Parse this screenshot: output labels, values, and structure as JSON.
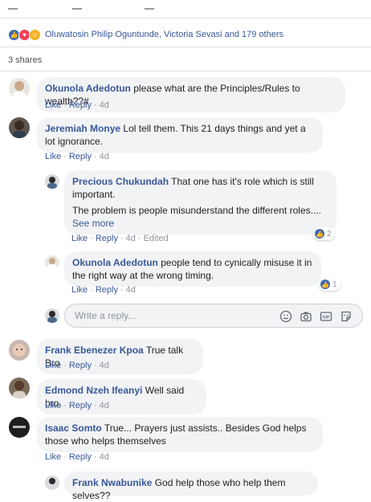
{
  "reactions": {
    "names": "Oluwatosin Philip Oguntunde, Victoria Sevasi and 179 others"
  },
  "shares": "3 shares",
  "actions": {
    "like": "Like",
    "reply": "Reply",
    "edited": "Edited"
  },
  "comments": [
    {
      "name": "Okunola Adedotun",
      "text": "please what are the Principles/Rules to wealth??#",
      "time": "4d"
    },
    {
      "name": "Jeremiah Monye",
      "text": "Lol tell them. This 21 days things and yet a lot ignorance.",
      "time": "4d"
    },
    {
      "name": "Precious Chukundah",
      "text": "That one has it's role which is still important.",
      "text2": "The problem is people misunderstand the different roles....",
      "see_more": "See more",
      "time": "4d",
      "reaction_count": "2"
    },
    {
      "name": "Okunola Adedotun",
      "text": "people tend to cynically misuse it in the right way at the wrong timing.",
      "time": "4d",
      "reaction_count": "1"
    },
    {
      "name": "Frank Ebenezer Kpoa",
      "text": "True talk Bro",
      "time": "4d"
    },
    {
      "name": "Edmond Nzeh Ifeanyi",
      "text": "Well said bro.",
      "time": "4d"
    },
    {
      "name": "Isaac Somto",
      "text": "True... Prayers just assists.. Besides God helps those who helps themselves",
      "time": "4d"
    },
    {
      "name": "Frank Nwabunike",
      "text": "God help those who help them selves??"
    }
  ],
  "reply_box": {
    "placeholder": "Write a reply..."
  },
  "icons": [
    "like-icon",
    "love-icon",
    "haha-icon",
    "emoji-icon",
    "camera-icon",
    "gif-icon",
    "sticker-icon"
  ],
  "colors": {
    "link": "#385898",
    "bubble": "#f2f3f5",
    "like_blue": "#4267b2"
  }
}
